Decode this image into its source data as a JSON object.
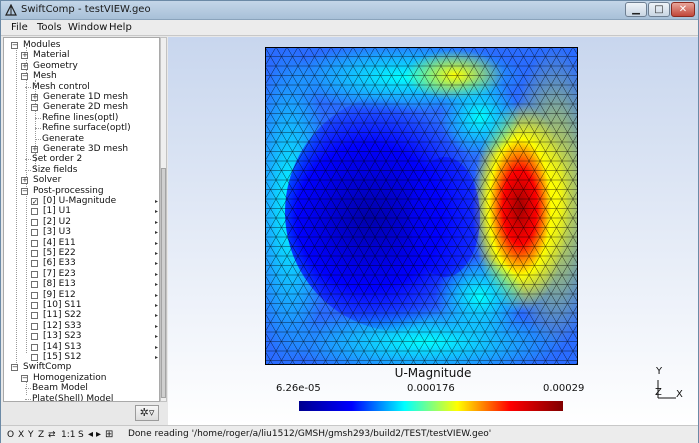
{
  "window": {
    "title": "SwiftComp - testVIEW.geo",
    "min_icon": "minimize-icon",
    "max_icon": "maximize-icon",
    "close_icon": "close-icon"
  },
  "menubar": {
    "items": [
      "File",
      "Tools",
      "Window",
      "Help"
    ]
  },
  "tree": {
    "rows": [
      {
        "label": "Modules",
        "expander": "−"
      },
      {
        "label": "Material",
        "expander": "+"
      },
      {
        "label": "Geometry",
        "expander": "+"
      },
      {
        "label": "Mesh",
        "expander": "−"
      },
      {
        "label": "Mesh control",
        "expander": ""
      },
      {
        "label": "Generate 1D mesh",
        "expander": "+"
      },
      {
        "label": "Generate 2D mesh",
        "expander": "−"
      },
      {
        "label": "Refine lines(optl)",
        "expander": ""
      },
      {
        "label": "Refine surface(optl)",
        "expander": ""
      },
      {
        "label": "Generate",
        "expander": ""
      },
      {
        "label": "Generate 3D mesh",
        "expander": "+"
      },
      {
        "label": "Set order 2",
        "expander": ""
      },
      {
        "label": "Size fields",
        "expander": ""
      },
      {
        "label": "Solver",
        "expander": "+"
      },
      {
        "label": "Post-processing",
        "expander": "−"
      },
      {
        "label": "[0] U-Magnitude",
        "checked": true
      },
      {
        "label": "[1] U1",
        "checked": false
      },
      {
        "label": "[2] U2",
        "checked": false
      },
      {
        "label": "[3] U3",
        "checked": false
      },
      {
        "label": "[4] E11",
        "checked": false
      },
      {
        "label": "[5] E22",
        "checked": false
      },
      {
        "label": "[6] E33",
        "checked": false
      },
      {
        "label": "[7] E23",
        "checked": false
      },
      {
        "label": "[8] E13",
        "checked": false
      },
      {
        "label": "[9] E12",
        "checked": false
      },
      {
        "label": "[10] S11",
        "checked": false
      },
      {
        "label": "[11] S22",
        "checked": false
      },
      {
        "label": "[12] S33",
        "checked": false
      },
      {
        "label": "[13] S23",
        "checked": false
      },
      {
        "label": "[14] S13",
        "checked": false
      },
      {
        "label": "[15] S12",
        "checked": false
      },
      {
        "label": "SwiftComp",
        "expander": "−"
      },
      {
        "label": "Homogenization",
        "expander": "−"
      },
      {
        "label": "Beam Model",
        "expander": ""
      },
      {
        "label": "Plate(Shell) Model",
        "expander": ""
      }
    ],
    "arrow_glyph": "▸",
    "tool_button": "✲▿"
  },
  "plot": {
    "scale_title": "U-Magnitude",
    "scale_min": "6.26e-05",
    "scale_mid": "0.000176",
    "scale_max": "0.00029",
    "axis_y": "Y",
    "axis_z": "Z",
    "axis_x": "X",
    "colors": [
      "#00008f",
      "#0000ff",
      "#00ffff",
      "#ffff00",
      "#ff0000",
      "#800000"
    ]
  },
  "statusbar": {
    "buttons": [
      "O",
      "X",
      "Y",
      "Z",
      "⇄",
      "1:1",
      "S"
    ],
    "message": "Done reading '/home/roger/a/liu1512/GMSH/gmsh293/build2/TEST/testVIEW.geo'"
  }
}
